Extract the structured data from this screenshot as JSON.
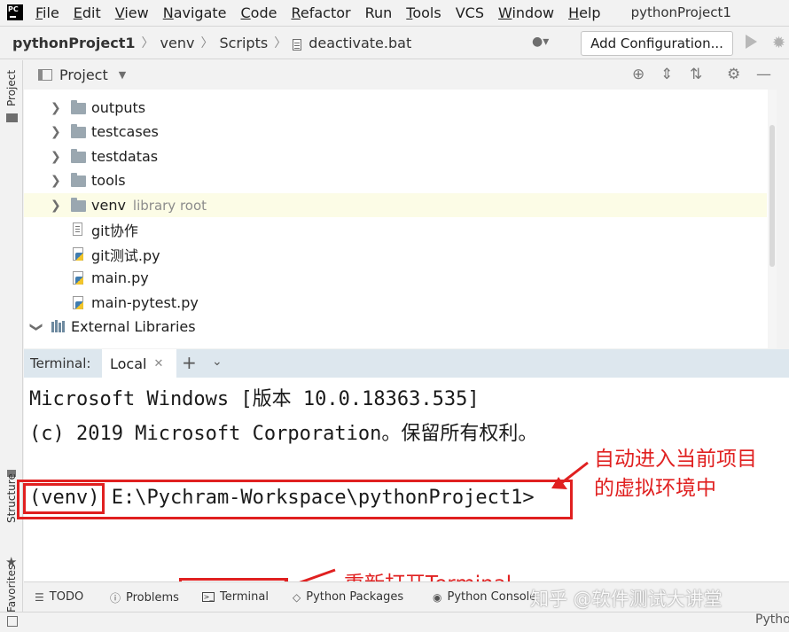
{
  "menu": {
    "items": [
      {
        "label": "File",
        "u": "F",
        "rest": "ile"
      },
      {
        "label": "Edit",
        "u": "E",
        "rest": "dit"
      },
      {
        "label": "View",
        "u": "V",
        "rest": "iew"
      },
      {
        "label": "Navigate",
        "u": "N",
        "rest": "avigate"
      },
      {
        "label": "Code",
        "u": "C",
        "rest": "ode"
      },
      {
        "label": "Refactor",
        "u": "R",
        "rest": "efactor"
      },
      {
        "label": "Run",
        "u": "",
        "rest": "Run"
      },
      {
        "label": "Tools",
        "u": "T",
        "rest": "ools"
      },
      {
        "label": "VCS",
        "u": "",
        "rest": "VCS"
      },
      {
        "label": "Window",
        "u": "W",
        "rest": "indow"
      },
      {
        "label": "Help",
        "u": "H",
        "rest": "elp"
      }
    ],
    "project_title": "pythonProject1"
  },
  "breadcrumb": {
    "project": "pythonProject1",
    "items": [
      "venv",
      "Scripts",
      "deactivate.bat"
    ]
  },
  "toolbar": {
    "add_configuration": "Add Configuration..."
  },
  "project_panel": {
    "title": "Project",
    "tree": [
      {
        "label": "outputs",
        "kind": "folder"
      },
      {
        "label": "testcases",
        "kind": "folder"
      },
      {
        "label": "testdatas",
        "kind": "folder"
      },
      {
        "label": "tools",
        "kind": "folder"
      },
      {
        "label": "venv",
        "sub": "library root",
        "kind": "folder"
      },
      {
        "label": "git协作",
        "kind": "text"
      },
      {
        "label": "git测试.py",
        "kind": "python"
      },
      {
        "label": "main.py",
        "kind": "python"
      },
      {
        "label": "main-pytest.py",
        "kind": "python"
      },
      {
        "label": "External Libraries",
        "kind": "library"
      }
    ]
  },
  "terminal": {
    "title": "Terminal:",
    "tab": "Local",
    "lines": [
      "Microsoft Windows [版本 10.0.18363.535]",
      "(c) 2019 Microsoft Corporation。保留所有权利。"
    ],
    "prompt_env": "(venv)",
    "prompt_path": "E:\\Pychram-Workspace\\pythonProject1>"
  },
  "annotations": {
    "venv_note": "自动进入当前项目的虚拟环境中",
    "reopen_note": "重新打开Terminal"
  },
  "side_labels": {
    "project": "Project",
    "structure": "Structure",
    "favorites": "Favorites"
  },
  "bottom_bar": {
    "todo": "TODO",
    "problems": "Problems",
    "terminal": "Terminal",
    "python_packages": "Python Packages",
    "python_console": "Python Console"
  },
  "status": {
    "right": "Pytho"
  },
  "watermark": "知乎 @软件测试大讲堂",
  "colors": {
    "annotation": "#e02020",
    "selected_row": "#fcfce6",
    "terminal_header": "#dde7ee"
  }
}
